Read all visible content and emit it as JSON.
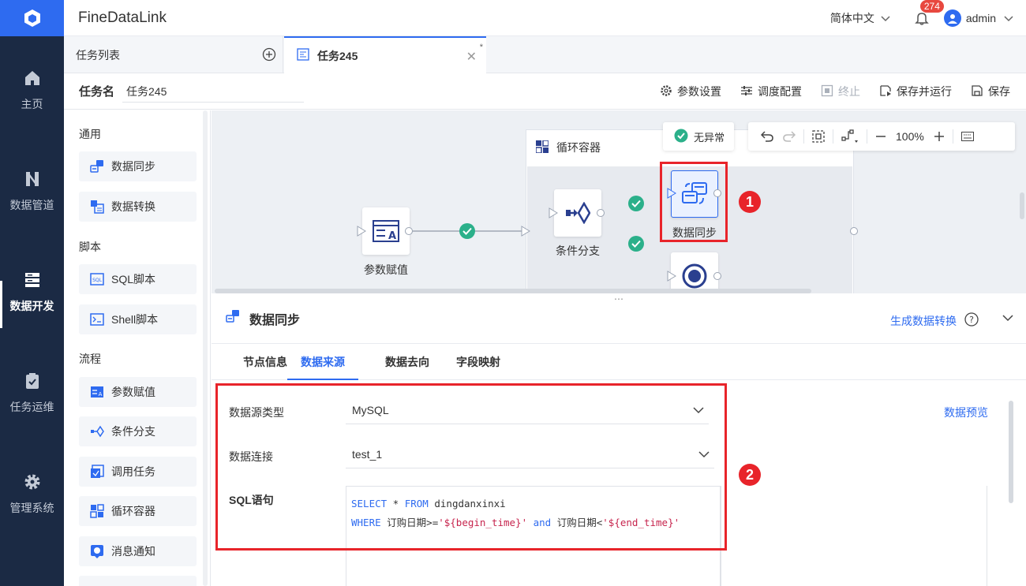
{
  "nav": {
    "items": [
      {
        "label": "主页",
        "icon": "home-icon"
      },
      {
        "label": "数据管道",
        "icon": "pipeline-icon"
      },
      {
        "label": "数据开发",
        "icon": "data-dev-icon"
      },
      {
        "label": "任务运维",
        "icon": "clipboard-check-icon"
      },
      {
        "label": "管理系统",
        "icon": "gear-icon"
      }
    ]
  },
  "header": {
    "brand": "FineDataLink",
    "language": "简体中文",
    "notification_count": "274",
    "user": "admin"
  },
  "tabs": {
    "list_label": "任务列表",
    "active_label": "任务245",
    "modified_mark": "*"
  },
  "task": {
    "name_label": "任务名",
    "name_value": "任务245",
    "actions": {
      "params": "参数设置",
      "schedule": "调度配置",
      "stop": "终止",
      "save_run": "保存并运行",
      "save": "保存"
    }
  },
  "components": {
    "groups": [
      {
        "title": "通用",
        "items": [
          "数据同步",
          "数据转换"
        ]
      },
      {
        "title": "脚本",
        "items": [
          "SQL脚本",
          "Shell脚本"
        ]
      },
      {
        "title": "流程",
        "items": [
          "参数赋值",
          "条件分支",
          "调用任务",
          "循环容器",
          "消息通知"
        ]
      }
    ]
  },
  "canvas": {
    "status": "无异常",
    "zoom": "100%",
    "container_label": "循环容器",
    "nodes": {
      "param": "参数赋值",
      "branch": "条件分支",
      "sync": "数据同步"
    },
    "markers": [
      "1",
      "2"
    ]
  },
  "detail": {
    "title": "数据同步",
    "generate_link": "生成数据转换",
    "tabs": [
      "节点信息",
      "数据来源",
      "数据去向",
      "字段映射"
    ],
    "active_tab": "数据来源",
    "source_type_label": "数据源类型",
    "source_type_value": "MySQL",
    "connection_label": "数据连接",
    "connection_value": "test_1",
    "sql_label": "SQL语句",
    "preview_link": "数据预览",
    "sql": {
      "kw_select": "SELECT",
      "star": " * ",
      "kw_from": "FROM",
      "table": " dingdanxinxi",
      "kw_where": "WHERE",
      "col1": " 订购日期>=",
      "val1": "'${begin_time}'",
      "kw_and": " and ",
      "col2": "订购日期<",
      "val2": "'${end_time}'"
    }
  },
  "colors": {
    "primary": "#2e6bf0",
    "nav_bg": "#1b2a44",
    "success": "#2bb08a",
    "highlight": "#e8242a"
  }
}
